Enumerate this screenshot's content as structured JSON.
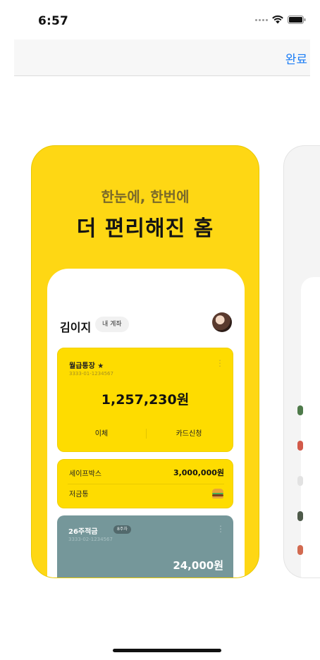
{
  "status_bar": {
    "time": "6:57"
  },
  "nav": {
    "done_label": "완료"
  },
  "card": {
    "tagline": "한눈에, 한번에",
    "headline": "더 편리해진 홈",
    "owner": "김이지",
    "owner_chip": "내 계좌",
    "account": {
      "name": "월급통장 ★",
      "number": "3333-01-1234567",
      "balance": "1,257,230원",
      "actions": [
        "이체",
        "카드신청"
      ]
    },
    "safebox": {
      "label": "세이프박스",
      "amount": "3,000,000원",
      "piggy_label": "저금통"
    },
    "savings": {
      "name": "26주적금",
      "badge": "8주차",
      "number": "3333-02-1234567",
      "balance": "24,000원"
    }
  },
  "colors": {
    "card_yellow": "#fed714",
    "accent_blue": "#1a7cf5",
    "savings_teal": "#75979a"
  }
}
